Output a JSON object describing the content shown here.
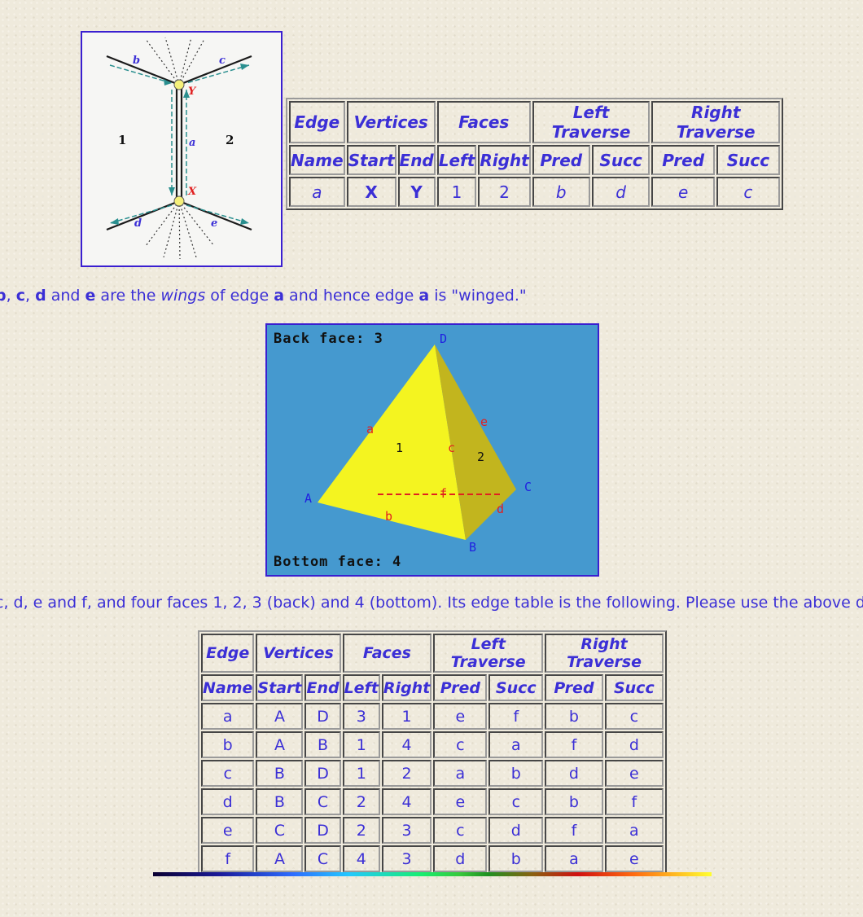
{
  "figure1": {
    "face_left": "1",
    "face_right": "2",
    "edge_a": "a",
    "edge_b": "b",
    "edge_c": "c",
    "edge_d": "d",
    "edge_e": "e",
    "vertex_x": "X",
    "vertex_y": "Y",
    "colors": {
      "border": "#3a1fd0",
      "edge": "#1a1a1a",
      "arrow": "#2a8f8f",
      "vertex": "#f5f07a",
      "vertex_label": "#e02020",
      "edge_label": "#3b2fd6"
    }
  },
  "table1": {
    "header1": [
      "Edge",
      "Vertices",
      "Faces",
      "Left Traverse",
      "Right Traverse"
    ],
    "header2": [
      "Name",
      "Start",
      "End",
      "Left",
      "Right",
      "Pred",
      "Succ",
      "Pred",
      "Succ"
    ],
    "row": [
      "a",
      "X",
      "Y",
      "1",
      "2",
      "b",
      "d",
      "e",
      "c"
    ]
  },
  "text1": {
    "p1": "b",
    "p2": ", ",
    "p3": "c",
    "p4": ", ",
    "p5": "d",
    "p6": " and ",
    "p7": "e",
    "p8": " are the ",
    "p9": "wings",
    "p10": " of edge ",
    "p11": "a",
    "p12": " and hence edge ",
    "p13": "a",
    "p14": " is \"winged.\""
  },
  "figure2": {
    "back_face": "Back face: 3",
    "bottom_face": "Bottom face: 4",
    "vertex_A": "A",
    "vertex_B": "B",
    "vertex_C": "C",
    "vertex_D": "D",
    "edge_a": "a",
    "edge_b": "b",
    "edge_c": "c",
    "edge_d": "d",
    "edge_e": "e",
    "edge_f": "f",
    "face1": "1",
    "face2": "2",
    "colors": {
      "background": "#4599cf",
      "front_face": "#f4f420",
      "side_face": "#c2b51e",
      "bottom_face": "#dcd820",
      "edge_label": "#e02020",
      "vertex_label": "#2020e0"
    }
  },
  "text2": "c, d, e and f, and four faces 1, 2, 3 (back) and 4 (bottom). Its edge table is the following. Please use the above d",
  "table2": {
    "header1": [
      "Edge",
      "Vertices",
      "Faces",
      "Left Traverse",
      "Right Traverse"
    ],
    "header2": [
      "Name",
      "Start",
      "End",
      "Left",
      "Right",
      "Pred",
      "Succ",
      "Pred",
      "Succ"
    ],
    "rows": [
      [
        "a",
        "A",
        "D",
        "3",
        "1",
        "e",
        "f",
        "b",
        "c"
      ],
      [
        "b",
        "A",
        "B",
        "1",
        "4",
        "c",
        "a",
        "f",
        "d"
      ],
      [
        "c",
        "B",
        "D",
        "1",
        "2",
        "a",
        "b",
        "d",
        "e"
      ],
      [
        "d",
        "B",
        "C",
        "2",
        "4",
        "e",
        "c",
        "b",
        "f"
      ],
      [
        "e",
        "C",
        "D",
        "2",
        "3",
        "c",
        "d",
        "f",
        "a"
      ],
      [
        "f",
        "A",
        "C",
        "4",
        "3",
        "d",
        "b",
        "a",
        "e"
      ]
    ]
  }
}
